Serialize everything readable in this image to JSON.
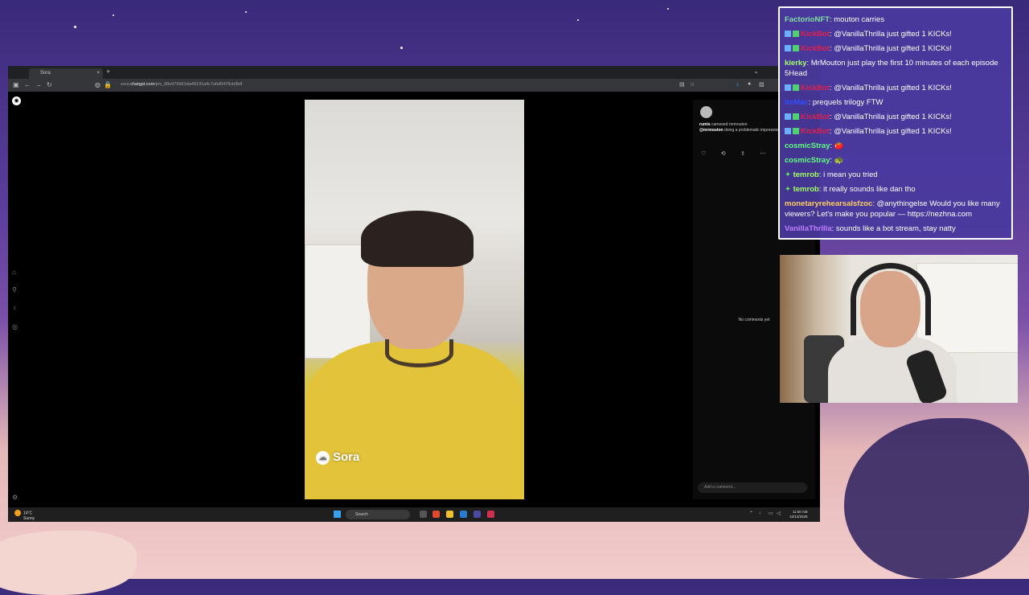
{
  "browser": {
    "tab_title": "Sora",
    "tab_close": "×",
    "new_tab": "+",
    "url_prefix": "sora.",
    "url_domain": "chatgpt.com",
    "url_path": "/p/s_68e976b61da48191a4c7a5d0478cb9b8"
  },
  "comments_panel": {
    "author_line": "rumis",
    "author_action": "cameoed mrmouton",
    "caption_handle": "@mrmouton",
    "caption_text": "doing a problematic impression of Jar Jar Binks",
    "no_comments": "No comments yet",
    "comment_placeholder": "Add a comment..."
  },
  "video": {
    "watermark": "Sora"
  },
  "taskbar": {
    "temperature": "14°C",
    "condition": "Sunny",
    "search_label": "Search",
    "time": "11:50 AM",
    "date": "10/12/2025"
  },
  "chat": {
    "messages": [
      {
        "user": "FactorioNFT",
        "user_color": "#7fe0a0",
        "text": "mouton carries"
      },
      {
        "user": "KickBot",
        "user_color": "#e0204a",
        "text": "@VanillaThrilla just gifted 1 KICKs!",
        "badges": true
      },
      {
        "user": "KickBot",
        "user_color": "#e0204a",
        "text": "@VanillaThrilla just gifted 1 KICKs!",
        "badges": true
      },
      {
        "user": "kierky",
        "user_color": "#a0ff60",
        "text": "MrMouton just play the first 10 minutes of each episode 5Head"
      },
      {
        "user": "KickBot",
        "user_color": "#e0204a",
        "text": "@VanillaThrilla just gifted 1 KICKs!",
        "badges": true
      },
      {
        "user": "ItsMac",
        "user_color": "#3050ff",
        "text": "prequels trilogy FTW"
      },
      {
        "user": "KickBot",
        "user_color": "#e0204a",
        "text": "@VanillaThrilla just gifted 1 KICKs!",
        "badges": true
      },
      {
        "user": "KickBot",
        "user_color": "#e0204a",
        "text": "@VanillaThrilla just gifted 1 KICKs!",
        "badges": true
      },
      {
        "user": "cosmicStray",
        "user_color": "#60ff80",
        "text": "🍅"
      },
      {
        "user": "cosmicStray",
        "user_color": "#60ff80",
        "text": "🐢"
      },
      {
        "user": "temrob",
        "user_color": "#a0ff60",
        "text": "i mean you tried",
        "star": true
      },
      {
        "user": "temrob",
        "user_color": "#a0ff60",
        "text": "it really sounds like dan tho",
        "star": true
      },
      {
        "user": "monetaryrehearsalsfzoc",
        "user_color": "#ffd060",
        "text": "@anythingelse Would you like many viewers? Let's make you popular — https://nezhna.com"
      },
      {
        "user": "VanillaThrilla",
        "user_color": "#c080ff",
        "text": "sounds like a bot stream, stay natty"
      }
    ]
  }
}
